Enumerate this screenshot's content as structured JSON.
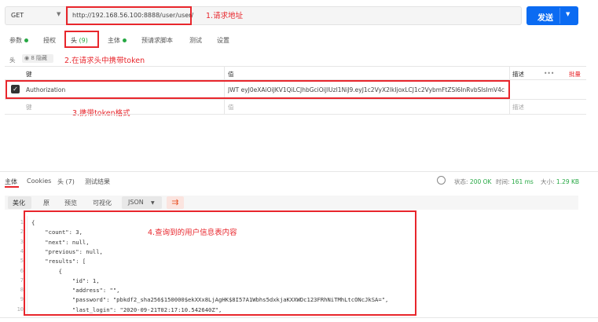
{
  "request": {
    "method": "GET",
    "url": "http://192.168.56.100:8888/user/user/",
    "send_label": "发送"
  },
  "tabs": {
    "params": "参数",
    "auth": "授权",
    "headers": "头",
    "headers_count": "(9)",
    "body": "主体",
    "pre_request": "预请求脚本",
    "tests": "测试",
    "settings": "设置"
  },
  "headers_sub": {
    "label": "头",
    "hidden_toggle": "8 隐藏"
  },
  "headers_table": {
    "col_key": "键",
    "col_value": "值",
    "col_desc": "描述",
    "more": "•••",
    "bulk_edit": "批量",
    "row_key": "Authorization",
    "row_value": "JWT eyJ0eXAiOiJKV1QiLCJhbGciOiJIUzI1NiJ9.eyJ1c2VyX2lkIjoxLCJ1c2VybmFtZSI6InRvbSIsImV4cC",
    "placeholder_key": "键",
    "placeholder_value": "值",
    "placeholder_desc": "描述"
  },
  "annotations": {
    "a1": "1.请求地址",
    "a2": "2.在请求头中携带token",
    "a3": "3.携带token格式",
    "a4": "4.查询到的用户信息表内容"
  },
  "response": {
    "tab_body": "主体",
    "tab_cookies": "Cookies",
    "tab_headers": "头 (7)",
    "tab_tests": "测试结果",
    "status_label": "状态:",
    "status_value": "200 OK",
    "time_label": "时间:",
    "time_value": "161 ms",
    "size_label": "大小:",
    "size_value": "1.29 KB",
    "format_pretty": "美化",
    "format_raw": "原",
    "format_preview": "预览",
    "format_visualize": "可视化",
    "format_type": "JSON"
  },
  "code_lines": [
    {
      "num": "1",
      "text": "{"
    },
    {
      "num": "2",
      "text": "    \"count\": 3,"
    },
    {
      "num": "3",
      "text": "    \"next\": null,"
    },
    {
      "num": "4",
      "text": "    \"previous\": null,"
    },
    {
      "num": "5",
      "text": "    \"results\": ["
    },
    {
      "num": "6",
      "text": "        {"
    },
    {
      "num": "7",
      "text": "            \"id\": 1,"
    },
    {
      "num": "8",
      "text": "            \"address\": \"\","
    },
    {
      "num": "9",
      "text": "            \"password\": \"pbkdf2_sha256$150000$ekXXx8LjAgHK$8I57A1Wbhs5dxkjaKXXWDc123FRhNiTMhLtcONcJkSA=\","
    },
    {
      "num": "10",
      "text": "            \"last_login\": \"2020-09-21T02:17:10.542640Z\","
    }
  ],
  "colors": {
    "accent": "#0b6bf2",
    "annotation": "#e8262c",
    "ok": "#27a844"
  }
}
